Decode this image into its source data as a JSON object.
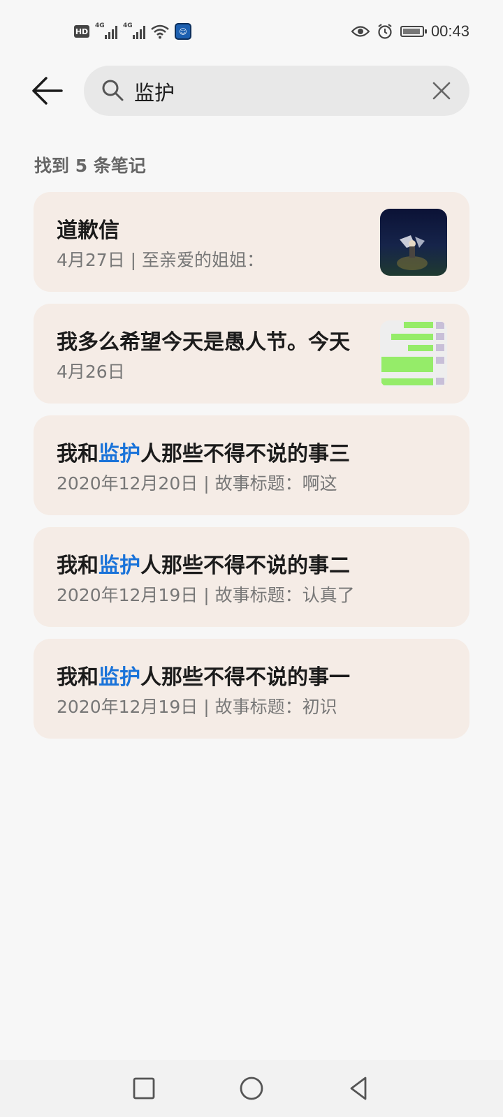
{
  "status_bar": {
    "left_icons": [
      "hd-icon",
      "signal-4g-icon",
      "signal-4g-icon",
      "wifi-icon",
      "app-notification-icon"
    ],
    "hd_label": "HD",
    "network_label_1": "4G",
    "network_label_2": "4G",
    "right_icons": [
      "eye-icon",
      "alarm-icon",
      "battery-icon"
    ],
    "time": "00:43"
  },
  "search": {
    "query": "监护",
    "icon": "search-icon",
    "clear_icon": "close-icon",
    "back_icon": "back-arrow-icon"
  },
  "results": {
    "count_label": "找到 5 条笔记",
    "items": [
      {
        "title": "道歉信",
        "subtitle": "4月27日 | 至亲爱的姐姐：",
        "thumbnail": "night-scene-image"
      },
      {
        "title": "我多么希望今天是愚人节。今天",
        "subtitle": "4月26日",
        "thumbnail": "chat-screenshot-image"
      },
      {
        "title_pre": "我和",
        "title_highlight": "监护",
        "title_post": "人那些不得不说的事三",
        "subtitle": "2020年12月20日 | 故事标题：啊这"
      },
      {
        "title_pre": "我和",
        "title_highlight": "监护",
        "title_post": "人那些不得不说的事二",
        "subtitle": "2020年12月19日 | 故事标题：认真了"
      },
      {
        "title_pre": "我和",
        "title_highlight": "监护",
        "title_post": "人那些不得不说的事一",
        "subtitle": "2020年12月19日 | 故事标题：初识"
      }
    ]
  },
  "nav_bar": {
    "buttons": [
      "recents-square-icon",
      "home-circle-icon",
      "back-triangle-icon"
    ]
  },
  "colors": {
    "background": "#f7f7f7",
    "card": "#f5ece6",
    "highlight": "#1a73d9",
    "search_box": "#e8e8e8"
  }
}
